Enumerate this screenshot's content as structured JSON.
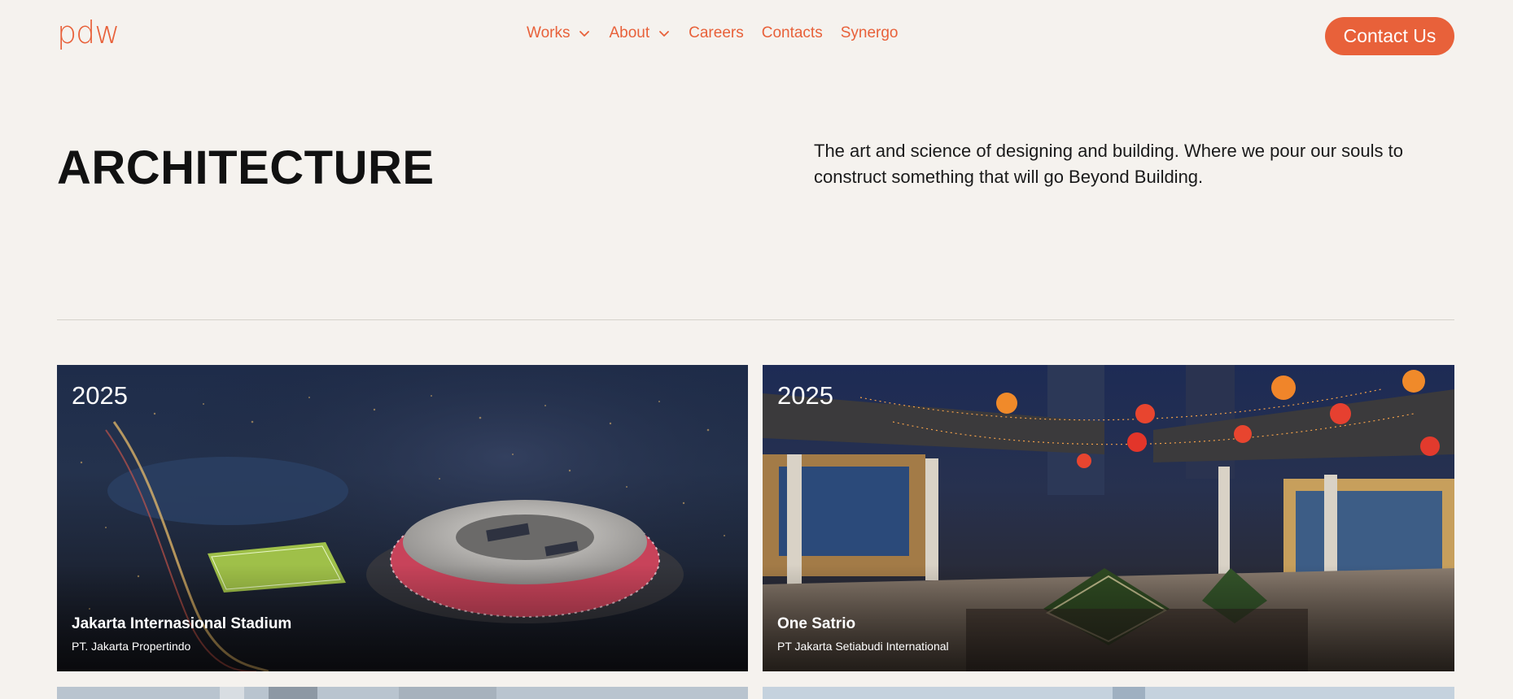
{
  "header": {
    "logo": "pdw",
    "nav": [
      {
        "label": "Works",
        "has_dropdown": true
      },
      {
        "label": "About",
        "has_dropdown": true
      },
      {
        "label": "Careers",
        "has_dropdown": false
      },
      {
        "label": "Contacts",
        "has_dropdown": false
      },
      {
        "label": "Synergo",
        "has_dropdown": false
      }
    ],
    "contact_button": "Contact Us"
  },
  "hero": {
    "title": "ARCHITECTURE",
    "description": "The art and science of designing and building. Where we pour our souls to construct something that will go Beyond Building."
  },
  "projects": [
    {
      "year": "2025",
      "name": "Jakarta Internasional Stadium",
      "client": "PT. Jakarta Propertindo"
    },
    {
      "year": "2025",
      "name": "One Satrio",
      "client": "PT Jakarta Setiabudi International"
    }
  ],
  "colors": {
    "accent": "#e8613a",
    "background": "#f5f2ee",
    "text": "#111111"
  }
}
